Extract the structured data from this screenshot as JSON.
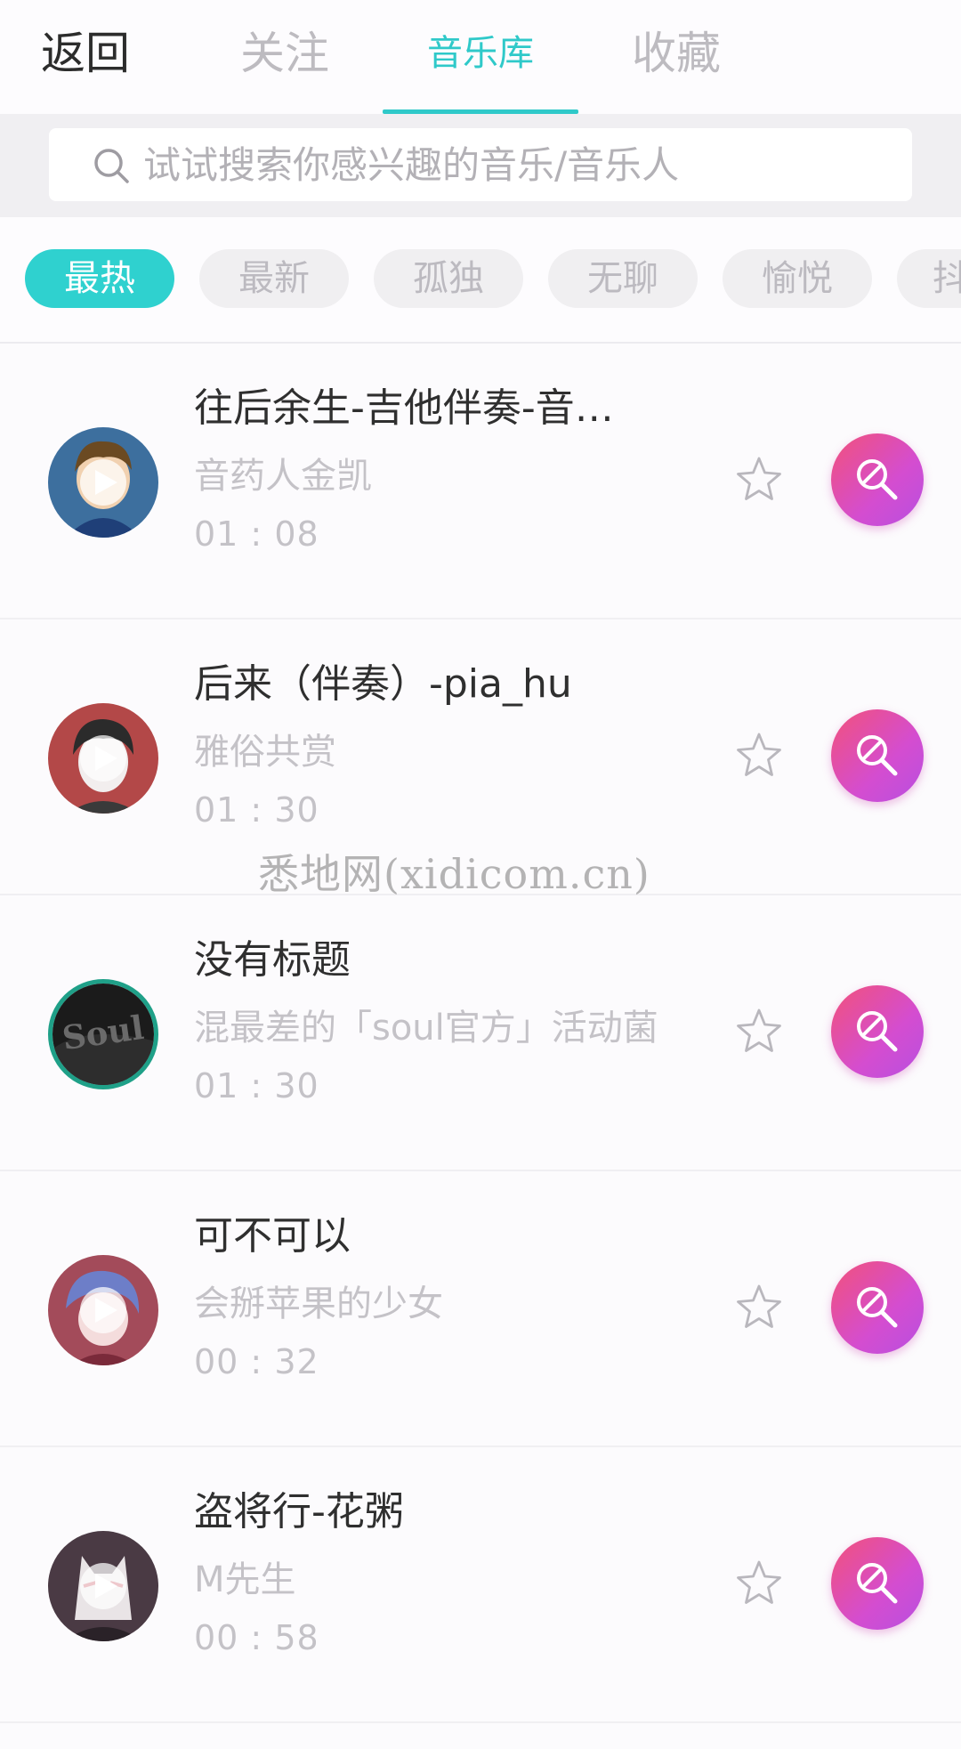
{
  "header": {
    "back_label": "返回",
    "tabs": [
      {
        "label": "关注",
        "active": false
      },
      {
        "label": "音乐库",
        "active": true
      },
      {
        "label": "收藏",
        "active": false
      }
    ],
    "accent_color": "#2fc9c9"
  },
  "search": {
    "placeholder": "试试搜索你感兴趣的音乐/音乐人",
    "icon": "search-icon"
  },
  "filters": {
    "chips": [
      {
        "label": "最热",
        "active": true
      },
      {
        "label": "最新",
        "active": false
      },
      {
        "label": "孤独",
        "active": false
      },
      {
        "label": "无聊",
        "active": false
      },
      {
        "label": "愉悦",
        "active": false
      },
      {
        "label": "抖",
        "active": false
      }
    ],
    "active_color": "#2fd1cf"
  },
  "songs": [
    {
      "title": "往后余生-吉他伴奏-音…",
      "artist": "音药人金凯",
      "duration": "01 : 08",
      "avatar": "avatar-cartoon-boy-blue"
    },
    {
      "title": "后来（伴奏）-pia_hu",
      "artist": "雅俗共赏",
      "duration": "01 : 30",
      "avatar": "avatar-sketch-boy-red"
    },
    {
      "title": "没有标题",
      "artist": "混最差的「soul官方」活动菌",
      "duration": "01 : 30",
      "avatar": "avatar-soul-logo"
    },
    {
      "title": "可不可以",
      "artist": "会掰苹果的少女",
      "duration": "00 : 32",
      "avatar": "avatar-anime-girl"
    },
    {
      "title": "盗将行-花粥",
      "artist": "M先生",
      "duration": "00 : 58",
      "avatar": "avatar-fox-mask"
    }
  ],
  "action_icons": {
    "favorite": "star-outline-icon",
    "sing": "microphone-icon"
  },
  "sing_gradient": [
    "#f2517a",
    "#d44dd0",
    "#b84fe0"
  ],
  "watermark": "悉地网(xidicom.cn)"
}
